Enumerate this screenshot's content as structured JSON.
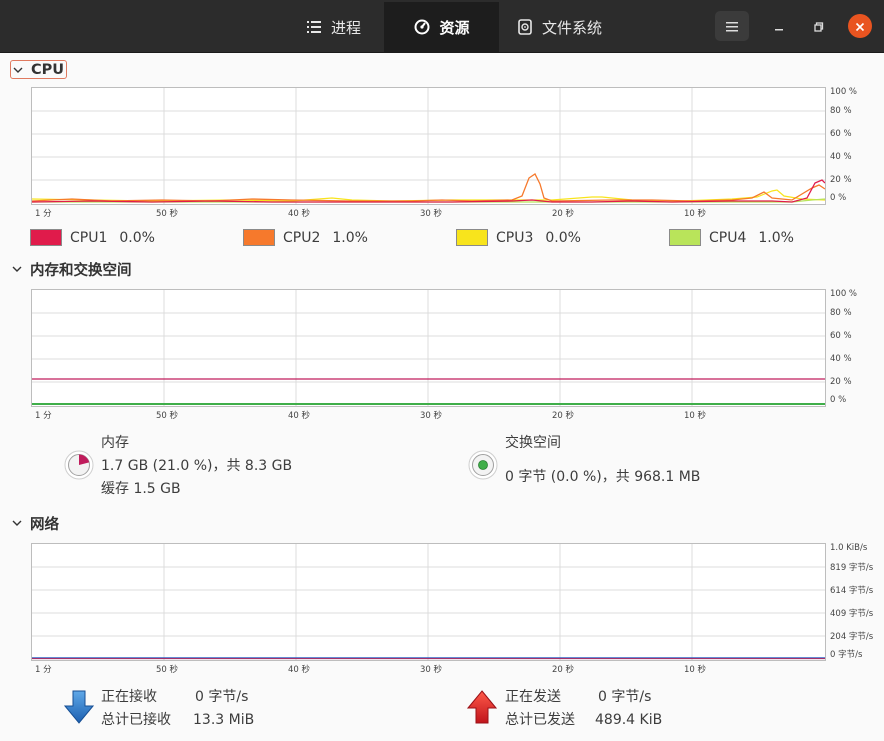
{
  "tabs": [
    {
      "label": "进程",
      "icon": "list-icon"
    },
    {
      "label": "资源",
      "icon": "gauge-icon"
    },
    {
      "label": "文件系统",
      "icon": "disk-icon"
    }
  ],
  "colors": {
    "accent": "#e95420",
    "cpu1": "#e01b4b",
    "cpu2": "#f6792c",
    "cpu3": "#f8e41c",
    "cpu4": "#b9e45a",
    "memory": "#c01c5c",
    "swap": "#3fae49",
    "receive": "#1c71d8",
    "send": "#e01b24"
  },
  "x_axis": [
    "1 分",
    "50 秒",
    "40 秒",
    "30 秒",
    "20 秒",
    "10 秒"
  ],
  "cpu": {
    "title": "CPU",
    "y_axis": [
      "100 %",
      "80 %",
      "60 %",
      "40 %",
      "20 %",
      "0 %"
    ],
    "legend": [
      {
        "name": "CPU1",
        "value": "0.0%"
      },
      {
        "name": "CPU2",
        "value": "1.0%"
      },
      {
        "name": "CPU3",
        "value": "0.0%"
      },
      {
        "name": "CPU4",
        "value": "1.0%"
      }
    ]
  },
  "memory": {
    "title": "内存和交换空间",
    "y_axis": [
      "100 %",
      "80 %",
      "60 %",
      "40 %",
      "20 %",
      "0 %"
    ],
    "mem_label": "内存",
    "mem_value": "1.7 GB (21.0 %)，共 8.3 GB",
    "cache_value": "缓存 1.5 GB",
    "mem_fraction": 0.21,
    "swap_label": "交换空间",
    "swap_value": "0 字节 (0.0 %)，共 968.1 MB",
    "swap_fraction": 0.0
  },
  "network": {
    "title": "网络",
    "y_axis": [
      "1.0 KiB/s",
      "819 字节/s",
      "614 字节/s",
      "409 字节/s",
      "204 字节/s",
      "0 字节/s"
    ],
    "receiving_label": "正在接收",
    "receiving_value": "0 字节/s",
    "total_received_label": "总计已接收",
    "total_received_value": "13.3 MiB",
    "sending_label": "正在发送",
    "sending_value": "0 字节/s",
    "total_sent_label": "总计已发送",
    "total_sent_value": "489.4 KiB"
  }
}
